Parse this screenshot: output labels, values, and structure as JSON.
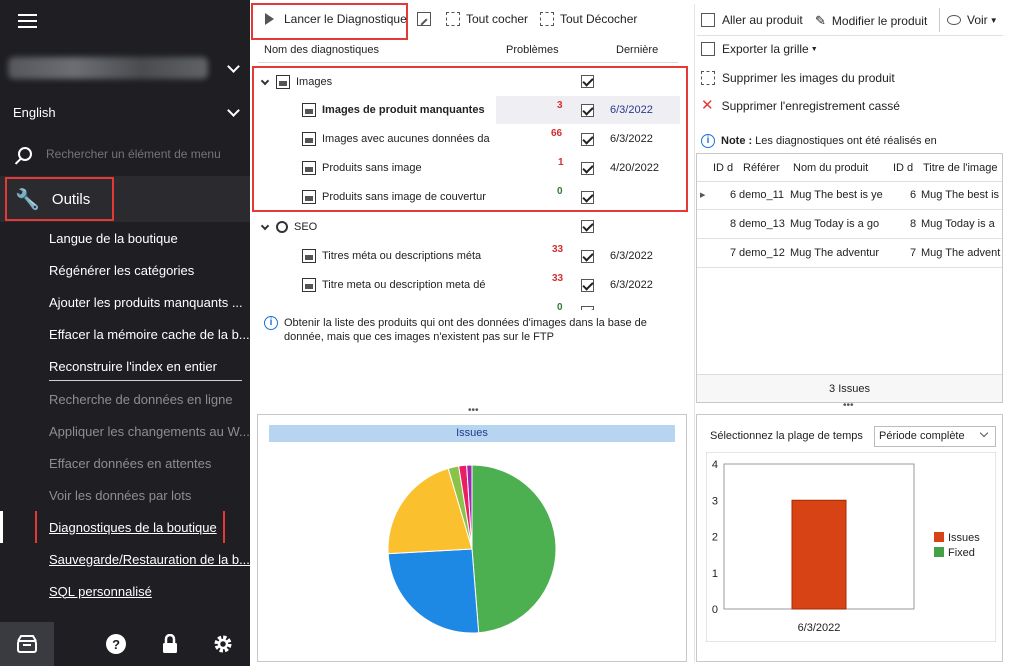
{
  "sidebar": {
    "language": "English",
    "search_placeholder": "Rechercher un élément de menu",
    "section_label": "Outils",
    "items": [
      {
        "label": "Langue de la boutique",
        "dim": false
      },
      {
        "label": "Régénérer les catégories",
        "dim": false
      },
      {
        "label": "Ajouter les produits manquants ...",
        "dim": false
      },
      {
        "label": "Effacer la mémoire cache de la b...",
        "dim": false
      },
      {
        "label": "Reconstruire l'index en entier",
        "dim": false
      },
      {
        "label": "Recherche de données en ligne",
        "dim": true
      },
      {
        "label": "Appliquer les changements au W...",
        "dim": true
      },
      {
        "label": "Effacer données en attentes",
        "dim": true
      },
      {
        "label": "Voir les données par lots",
        "dim": true
      },
      {
        "label": "Diagnostiques de la boutique",
        "dim": false
      },
      {
        "label": "Sauvegarde/Restauration de la b...",
        "dim": false
      },
      {
        "label": "SQL personnalisé",
        "dim": false
      }
    ]
  },
  "toolbar": {
    "run_label": "Lancer le Diagnostique",
    "check_all": "Tout cocher",
    "uncheck_all": "Tout Décocher"
  },
  "grid": {
    "headers": [
      "Nom des diagnostiques",
      "Problèmes",
      "Dernière"
    ],
    "groups": [
      {
        "name": "Images",
        "rows": [
          {
            "name": "Images de produit manquantes",
            "count": "3",
            "date": "6/3/2022"
          },
          {
            "name": "Images avec aucunes données da",
            "count": "66",
            "date": "6/3/2022"
          },
          {
            "name": "Produits sans image",
            "count": "1",
            "date": "4/20/2022"
          },
          {
            "name": "Produits sans image de couvertur",
            "count": "0",
            "date": ""
          }
        ]
      },
      {
        "name": "SEO",
        "rows": [
          {
            "name": "Titres méta ou descriptions méta",
            "count": "33",
            "date": "6/3/2022"
          },
          {
            "name": "Titre meta ou description meta dé",
            "count": "33",
            "date": "6/3/2022"
          },
          {
            "name": "",
            "count": "0",
            "date": ""
          }
        ]
      }
    ],
    "info": "Obtenir la liste des produits qui ont des données d'images dans la base de donnée, mais que ces images n'existent pas sur le FTP"
  },
  "pie": {
    "title": "Issues",
    "chart_data": {
      "type": "pie",
      "slices": [
        {
          "value": 48,
          "color": "#4caf50"
        },
        {
          "value": 25,
          "color": "#1e88e5"
        },
        {
          "value": 21,
          "color": "#fbc02d"
        },
        {
          "value": 2,
          "color": "#8bc34a"
        },
        {
          "value": 1.5,
          "color": "#e91e63"
        },
        {
          "value": 1,
          "color": "#9c27b0"
        }
      ]
    }
  },
  "right": {
    "goto_product": "Aller au produit",
    "edit_product": "Modifier le produit",
    "view": "Voir",
    "export": "Exporter la grille",
    "delete_images": "Supprimer les images du produit",
    "delete_broken": "Supprimer l'enregistrement cassé",
    "note_bold": "Note :",
    "note_text": "Les diagnostiques ont été réalisés en",
    "table_headers": [
      "ID d",
      "Référer",
      "Nom du produit",
      "ID d",
      "Titre de l'image"
    ],
    "table_rows": [
      [
        "6",
        "demo_11",
        "Mug The best is ye",
        "6",
        "Mug The best is"
      ],
      [
        "8",
        "demo_13",
        "Mug Today is a go",
        "8",
        "Mug Today is a"
      ],
      [
        "7",
        "demo_12",
        "Mug The adventur",
        "7",
        "Mug The advent"
      ]
    ],
    "footer": "3 Issues",
    "range_label": "Sélectionnez la plage de temps",
    "range_value": "Période complète"
  },
  "bar": {
    "chart_data": {
      "type": "bar",
      "categories": [
        "6/3/2022"
      ],
      "series": [
        {
          "name": "Issues",
          "values": [
            3
          ],
          "color": "#d84315"
        },
        {
          "name": "Fixed",
          "values": [
            0
          ],
          "color": "#43a047"
        }
      ],
      "ylim": [
        0,
        4
      ],
      "yticks": [
        "0",
        "1",
        "2",
        "3",
        "4"
      ]
    }
  }
}
